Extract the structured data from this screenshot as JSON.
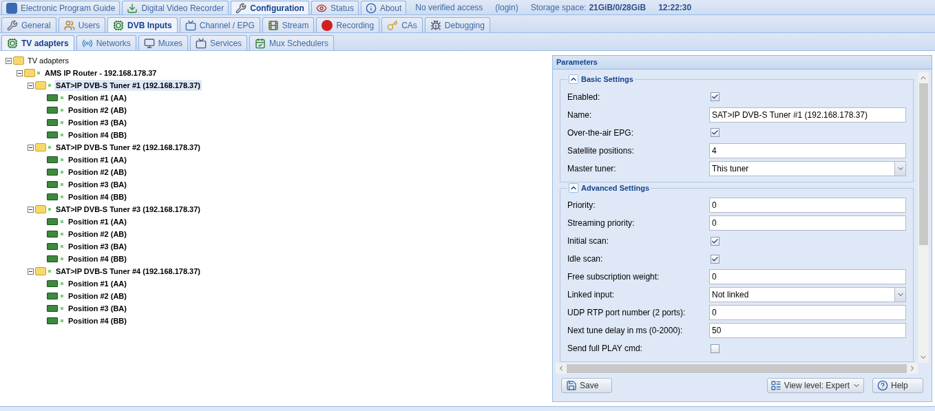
{
  "top_tabs": [
    {
      "label": "Electronic Program Guide",
      "selected": false
    },
    {
      "label": "Digital Video Recorder",
      "selected": false
    },
    {
      "label": "Configuration",
      "selected": true
    },
    {
      "label": "Status",
      "selected": false
    },
    {
      "label": "About",
      "selected": false
    }
  ],
  "status": {
    "access": "No verified access",
    "login": "(login)",
    "storage_label": "Storage space:",
    "storage_value": "21GiB/0/28GiB",
    "time": "12:22:30"
  },
  "config_tabs": [
    {
      "label": "General",
      "selected": false
    },
    {
      "label": "Users",
      "selected": false
    },
    {
      "label": "DVB Inputs",
      "selected": true
    },
    {
      "label": "Channel / EPG",
      "selected": false
    },
    {
      "label": "Stream",
      "selected": false
    },
    {
      "label": "Recording",
      "selected": false
    },
    {
      "label": "CAs",
      "selected": false
    },
    {
      "label": "Debugging",
      "selected": false
    }
  ],
  "dvb_tabs": [
    {
      "label": "TV adapters",
      "selected": true
    },
    {
      "label": "Networks",
      "selected": false
    },
    {
      "label": "Muxes",
      "selected": false
    },
    {
      "label": "Services",
      "selected": false
    },
    {
      "label": "Mux Schedulers",
      "selected": false
    }
  ],
  "tree": {
    "label": "TV adapters",
    "expanded": true,
    "selected": false,
    "children": [
      {
        "label": "AMS IP Router - 192.168.178.37",
        "expanded": true,
        "selected": false,
        "children": [
          {
            "label": "SAT>IP DVB-S Tuner #1 (192.168.178.37)",
            "expanded": true,
            "selected": true,
            "children": [
              {
                "label": "Position #1 (AA)",
                "selected": false
              },
              {
                "label": "Position #2 (AB)",
                "selected": false
              },
              {
                "label": "Position #3 (BA)",
                "selected": false
              },
              {
                "label": "Position #4 (BB)",
                "selected": false
              }
            ]
          },
          {
            "label": "SAT>IP DVB-S Tuner #2 (192.168.178.37)",
            "expanded": true,
            "selected": false,
            "children": [
              {
                "label": "Position #1 (AA)",
                "selected": false
              },
              {
                "label": "Position #2 (AB)",
                "selected": false
              },
              {
                "label": "Position #3 (BA)",
                "selected": false
              },
              {
                "label": "Position #4 (BB)",
                "selected": false
              }
            ]
          },
          {
            "label": "SAT>IP DVB-S Tuner #3 (192.168.178.37)",
            "expanded": true,
            "selected": false,
            "children": [
              {
                "label": "Position #1 (AA)",
                "selected": false
              },
              {
                "label": "Position #2 (AB)",
                "selected": false
              },
              {
                "label": "Position #3 (BA)",
                "selected": false
              },
              {
                "label": "Position #4 (BB)",
                "selected": false
              }
            ]
          },
          {
            "label": "SAT>IP DVB-S Tuner #4 (192.168.178.37)",
            "expanded": true,
            "selected": false,
            "children": [
              {
                "label": "Position #1 (AA)",
                "selected": false
              },
              {
                "label": "Position #2 (AB)",
                "selected": false
              },
              {
                "label": "Position #3 (BA)",
                "selected": false
              },
              {
                "label": "Position #4 (BB)",
                "selected": false
              }
            ]
          }
        ]
      }
    ]
  },
  "parameters": {
    "title": "Parameters",
    "sections": [
      {
        "title": "Basic Settings",
        "expanded": true,
        "fields": [
          {
            "kind": "checkbox",
            "label": "Enabled:",
            "checked": true
          },
          {
            "kind": "text",
            "label": "Name:",
            "value": "SAT>IP DVB-S Tuner #1 (192.168.178.37)"
          },
          {
            "kind": "checkbox",
            "label": "Over-the-air EPG:",
            "checked": true
          },
          {
            "kind": "text",
            "label": "Satellite positions:",
            "value": "4"
          },
          {
            "kind": "select",
            "label": "Master tuner:",
            "value": "This tuner"
          }
        ]
      },
      {
        "title": "Advanced Settings",
        "expanded": true,
        "fields": [
          {
            "kind": "text",
            "label": "Priority:",
            "value": "0"
          },
          {
            "kind": "text",
            "label": "Streaming priority:",
            "value": "0"
          },
          {
            "kind": "checkbox",
            "label": "Initial scan:",
            "checked": true
          },
          {
            "kind": "checkbox",
            "label": "Idle scan:",
            "checked": true
          },
          {
            "kind": "text",
            "label": "Free subscription weight:",
            "value": "0"
          },
          {
            "kind": "select",
            "label": "Linked input:",
            "value": "Not linked"
          },
          {
            "kind": "text",
            "label": "UDP RTP port number (2 ports):",
            "value": "0"
          },
          {
            "kind": "text",
            "label": "Next tune delay in ms (0-2000):",
            "value": "50"
          },
          {
            "kind": "checkbox",
            "label": "Send full PLAY cmd:",
            "checked": false
          }
        ]
      }
    ],
    "buttons": {
      "save": "Save",
      "view_level": "View level: Expert",
      "help": "Help"
    }
  }
}
